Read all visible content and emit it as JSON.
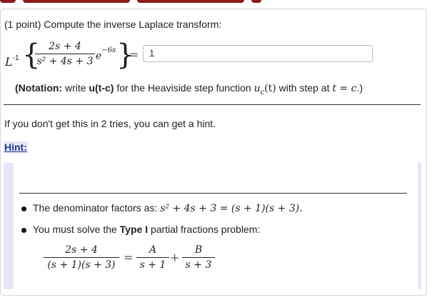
{
  "problem": {
    "points": "(1 point)",
    "instruction": "Compute the inverse Laplace transform:",
    "operator": "L",
    "operator_sup": "-1",
    "numerator": "2s + 4",
    "denominator": "s² + 4s + 3",
    "exp_base": "e",
    "exp_power": "−6s",
    "equals": "=",
    "answer_value": "1",
    "notation_label": "(Notation:",
    "notation_text_1": "write",
    "notation_code": "u(t-c)",
    "notation_text_2": "for the Heaviside step function",
    "notation_math_1": "u",
    "notation_math_1_sub": "c",
    "notation_math_1_arg": "(t)",
    "notation_text_3": "with step at",
    "notation_math_2": "t = c",
    "notation_end": ".)"
  },
  "hint_section": {
    "tries_text": "If you don't get this in 2 tries, you can get a hint.",
    "hint_link": "Hint:",
    "bullet1_text": "The denominator factors as:",
    "bullet1_math": "s² + 4s + 3 = (s + 1)(s + 3).",
    "bullet2_text_1": "You must solve the",
    "bullet2_bold": "Type I",
    "bullet2_text_2": "partial fractions problem:",
    "pf_left_num": "2s + 4",
    "pf_left_den": "(s + 1)(s + 3)",
    "pf_eq": "=",
    "pf_a_num": "A",
    "pf_a_den": "s + 1",
    "pf_plus": "+",
    "pf_b_num": "B",
    "pf_b_den": "s + 3"
  },
  "colors": {
    "top_bar": "#8b1a1a",
    "hint_link": "#1a3c9c",
    "hint_box_bg": "#e6e6fb"
  }
}
